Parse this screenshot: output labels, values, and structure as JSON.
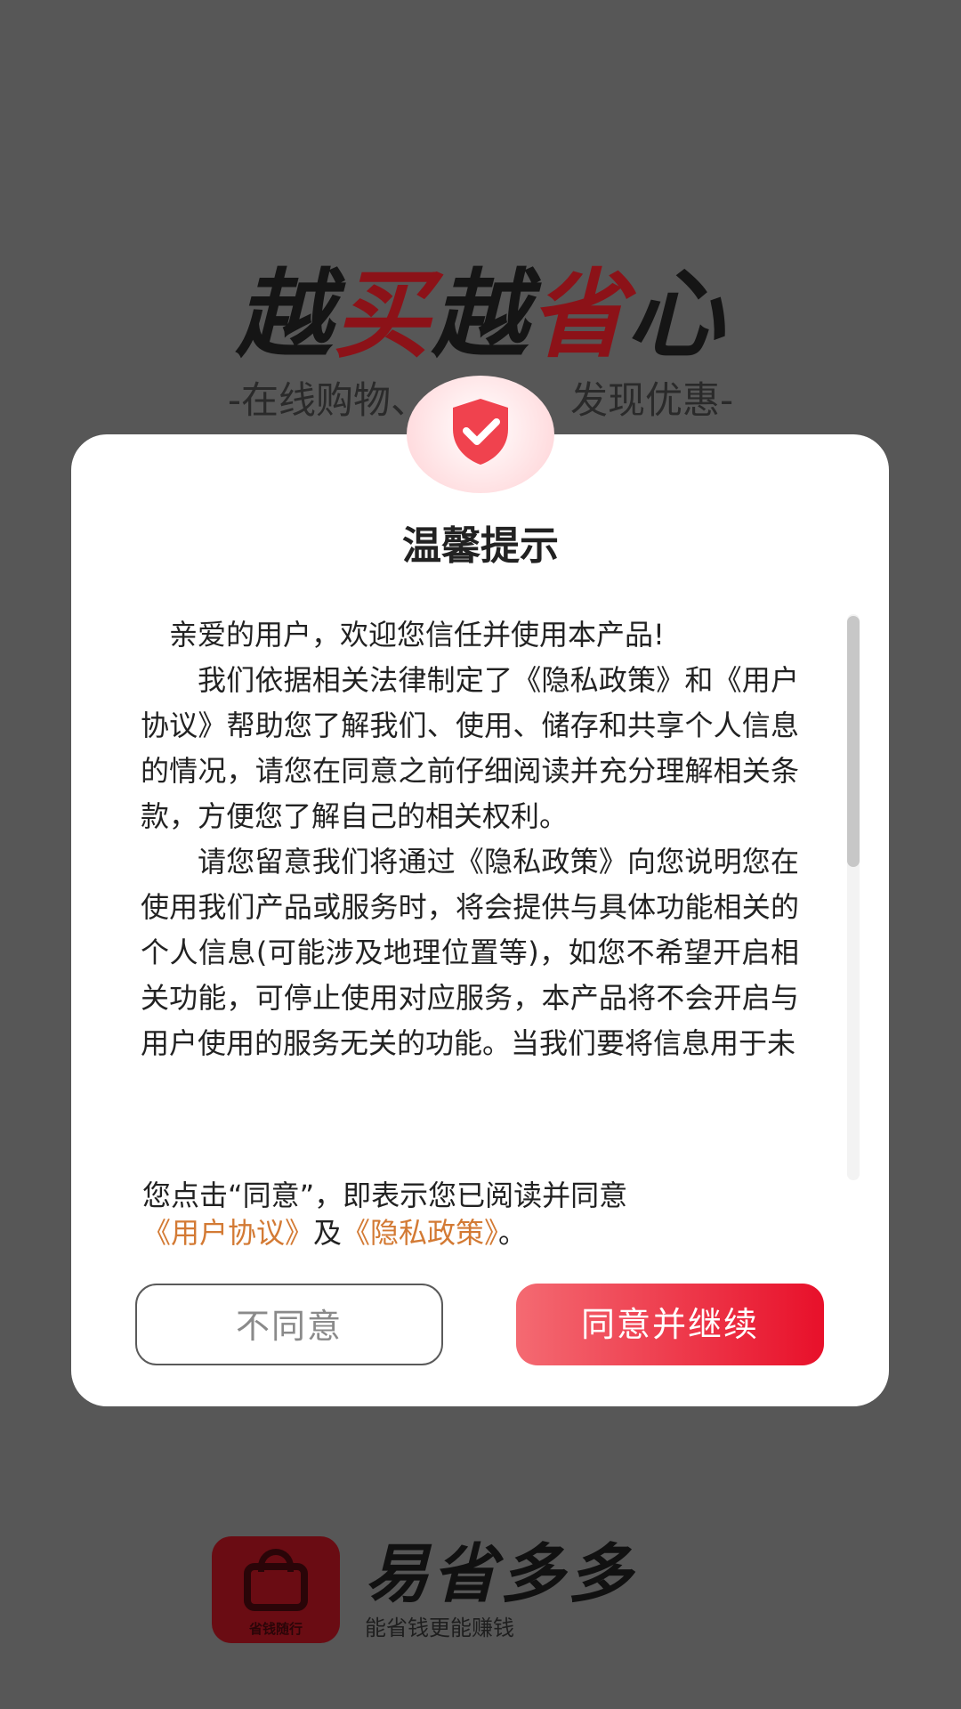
{
  "splash": {
    "title_dark_1": "越",
    "title_red_1": "买",
    "title_dark_2": "越",
    "title_red_2": "省",
    "title_dark_3": "心",
    "subtitle_left": "-在线购物、",
    "subtitle_right": "发现优惠-",
    "brand_name": "易省多多",
    "brand_slogan": "能省钱更能赚钱",
    "logo_caption": "省钱随行"
  },
  "dialog": {
    "title": "温馨提示",
    "paragraphs": [
      "亲爱的用户，欢迎您信任并使用本产品!",
      "我们依据相关法律制定了《隐私政策》和《用户协议》帮助您了解我们、使用、储存和共享个人信息的情况，请您在同意之前仔细阅读并充分理解相关条款，方便您了解自己的相关权利。",
      "请您留意我们将通过《隐私政策》向您说明您在使用我们产品或服务时，将会提供与具体功能相关的个人信息(可能涉及地理位置等)，如您不希望开启相关功能，可停止使用对应服务，本产品将不会开启与用户使用的服务无关的功能。当我们要将信息用于未"
    ],
    "consent": {
      "prefix": "您点击“同意”，即表示您已阅读并同意",
      "user_agreement": "《用户协议》",
      "and": "及",
      "privacy_policy": "《隐私政策》",
      "suffix": "。"
    },
    "decline_label": "不同意",
    "accept_label": "同意并继续"
  },
  "colors": {
    "accent": "#e8102a",
    "link": "#d37a34",
    "overlay": "#575757"
  },
  "icons": {
    "badge": "shield-check-icon"
  }
}
